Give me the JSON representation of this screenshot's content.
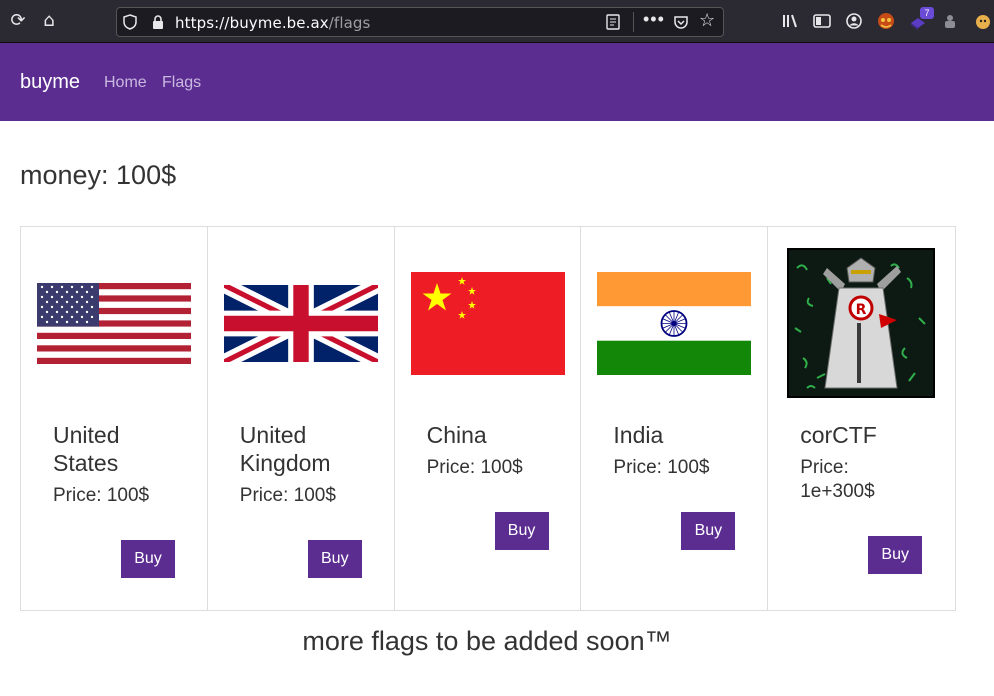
{
  "browser": {
    "url_host": "https://buyme.be.ax",
    "url_path": "/flags",
    "extension_badge": "7"
  },
  "navbar": {
    "brand": "buyme",
    "links": [
      "Home",
      "Flags"
    ]
  },
  "money_label": "money: 100$",
  "flags": [
    {
      "name": "United States",
      "price": "Price: 100$",
      "buy_label": "Buy",
      "image": "us-flag"
    },
    {
      "name": "United Kingdom",
      "price": "Price: 100$",
      "buy_label": "Buy",
      "image": "uk-flag"
    },
    {
      "name": "China",
      "price": "Price: 100$",
      "buy_label": "Buy",
      "image": "china-flag"
    },
    {
      "name": "India",
      "price": "Price: 100$",
      "buy_label": "Buy",
      "image": "india-flag"
    },
    {
      "name": "corCTF",
      "price": "Price: 1e+300$",
      "buy_label": "Buy",
      "image": "corctf-flag"
    }
  ],
  "footer_note": "more flags to be added soon™",
  "colors": {
    "navbar": "#5c2d91",
    "button": "#5c2d91",
    "chrome": "#2b2a33"
  }
}
